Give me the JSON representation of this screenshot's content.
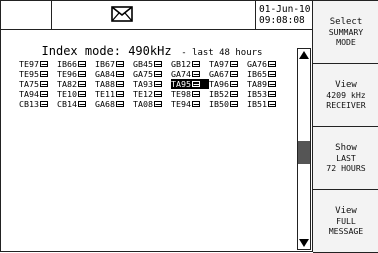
{
  "header": {
    "date": "01-Jun-10",
    "time": "09:08:08"
  },
  "title": {
    "main": "Index mode: 490kHz",
    "sub": "- last 48 hours"
  },
  "stations": [
    [
      "TE97",
      "IB66",
      "IB67",
      "GB45",
      "GB12",
      "TA97",
      "GA76"
    ],
    [
      "TE95",
      "TE96",
      "GA84",
      "GA75",
      "GA74",
      "GA67",
      "IB65"
    ],
    [
      "TA75",
      "TA82",
      "TA88",
      "TA93",
      "TA95",
      "TA96",
      "TA89"
    ],
    [
      "TA94",
      "TE10",
      "TE11",
      "TE12",
      "TE98",
      "IB52",
      "IB53"
    ],
    [
      "CB13",
      "CB14",
      "GA68",
      "TA08",
      "TE94",
      "IB50",
      "IB51"
    ]
  ],
  "selected": {
    "row": 2,
    "col": 4
  },
  "scroll": {
    "position": 0.52,
    "visible_fraction": 0.13
  },
  "softkeys": [
    [
      "Select",
      "SUMMARY",
      "MODE"
    ],
    [
      "View",
      "4209 kHz",
      "RECEIVER"
    ],
    [
      "Show",
      "LAST",
      "72 HOURS"
    ],
    [
      "View",
      "FULL",
      "MESSAGE"
    ]
  ]
}
